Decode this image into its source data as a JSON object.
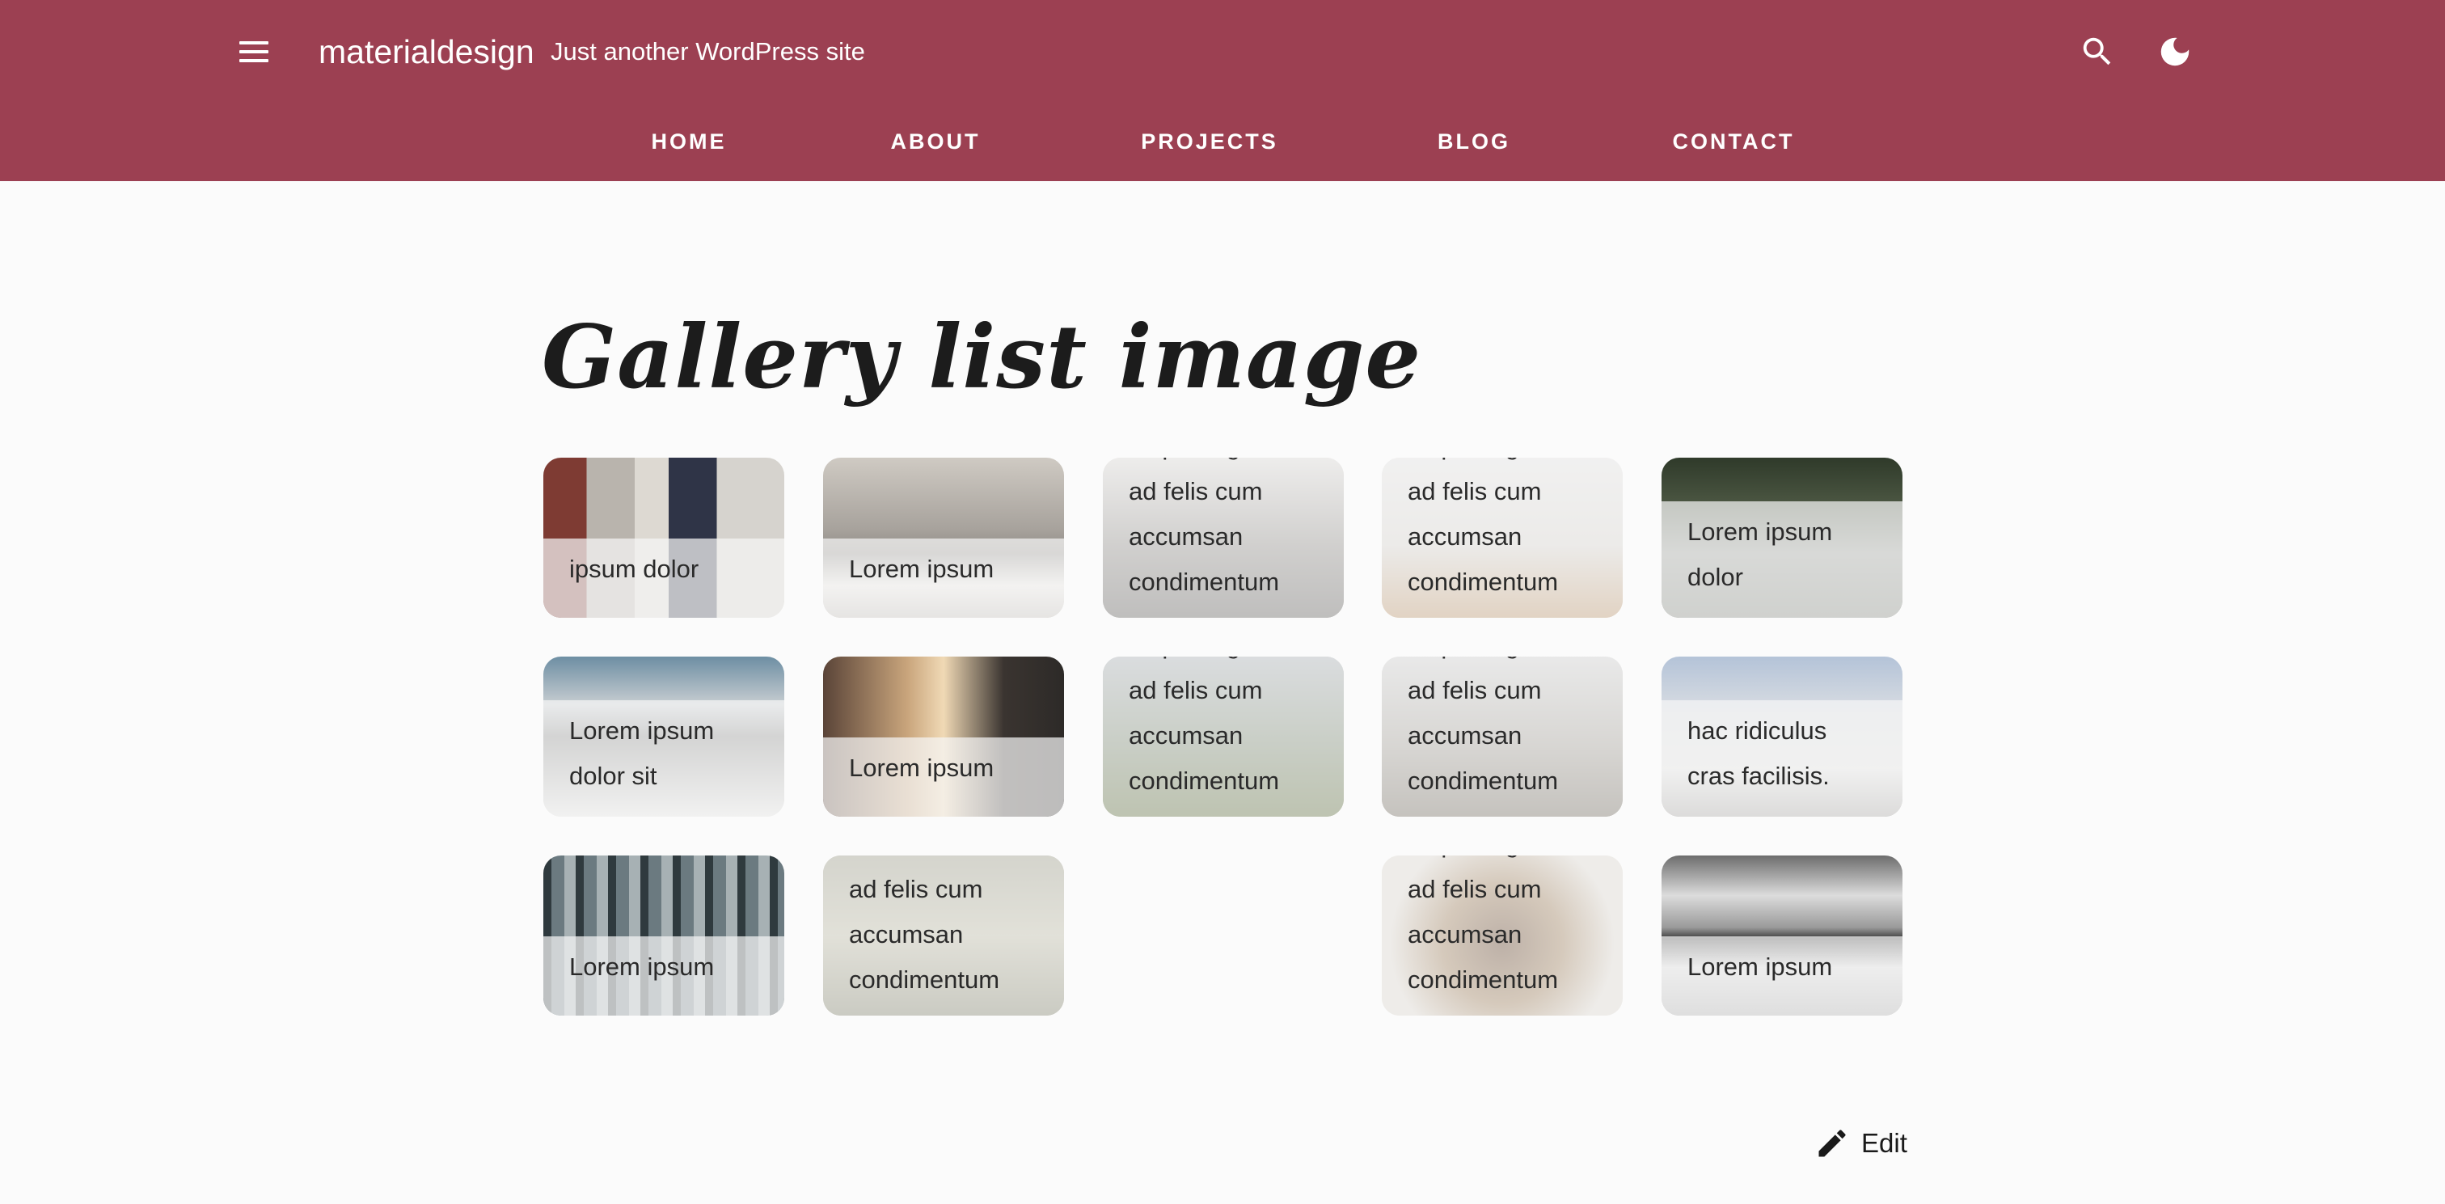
{
  "header": {
    "site_title": "materialdesign",
    "tagline": "Just another WordPress site",
    "nav": [
      "HOME",
      "ABOUT",
      "PROJECTS",
      "BLOG",
      "CONTACT"
    ]
  },
  "page": {
    "title": "Gallery list image",
    "edit_label": "Edit"
  },
  "gallery": [
    {
      "caption": "ipsum dolor"
    },
    {
      "caption": "Lorem ipsum"
    },
    {
      "caption": "adipiscing elit, ad felis cum accumsan condimentum"
    },
    {
      "caption": "adipiscing elit, ad felis cum accumsan condimentum"
    },
    {
      "caption": "Lorem ipsum dolor"
    },
    {
      "caption": "Lorem ipsum dolor sit"
    },
    {
      "caption": "Lorem ipsum"
    },
    {
      "caption": "adipiscing elit, ad felis cum accumsan condimentum"
    },
    {
      "caption": "adipiscing elit, ad felis cum accumsan condimentum"
    },
    {
      "caption": "hac ridiculus cras facilisis."
    },
    {
      "caption": "Lorem ipsum"
    },
    {
      "caption": "ad felis cum accumsan condimentum"
    },
    {
      "caption": "adipiscing elit, ad felis cum accumsan condimentum"
    },
    {
      "caption": "Lorem ipsum"
    }
  ],
  "colors": {
    "header_bg": "#9c4052",
    "page_bg": "#fbfbfb"
  }
}
